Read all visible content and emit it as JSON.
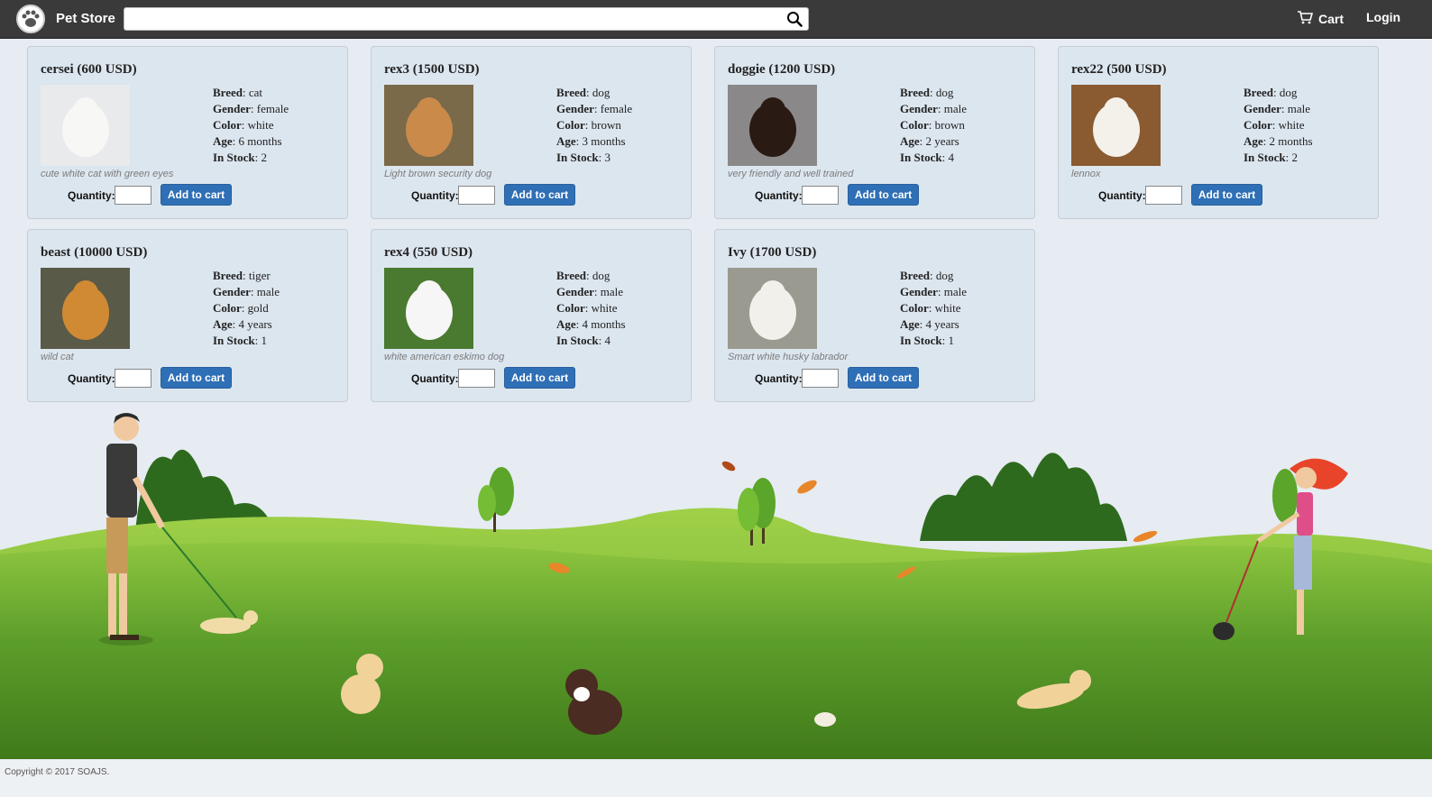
{
  "header": {
    "brand": "Pet Store",
    "search": {
      "value": "",
      "placeholder": ""
    },
    "cart_label": "Cart",
    "login_label": "Login"
  },
  "labels": {
    "breed": "Breed",
    "gender": "Gender",
    "color": "Color",
    "age": "Age",
    "in_stock": "In Stock",
    "quantity": "Quantity:",
    "add_to_cart": "Add to cart"
  },
  "pets": [
    {
      "title": "cersei (600 USD)",
      "breed": "cat",
      "gender": "female",
      "color": "white",
      "age": "6 months",
      "in_stock": "2",
      "description": "cute white cat with green eyes"
    },
    {
      "title": "rex3 (1500 USD)",
      "breed": "dog",
      "gender": "female",
      "color": "brown",
      "age": "3 months",
      "in_stock": "3",
      "description": "Light brown security dog"
    },
    {
      "title": "doggie (1200 USD)",
      "breed": "dog",
      "gender": "male",
      "color": "brown",
      "age": "2 years",
      "in_stock": "4",
      "description": "very friendly and well trained"
    },
    {
      "title": "rex22 (500 USD)",
      "breed": "dog",
      "gender": "male",
      "color": "white",
      "age": "2 months",
      "in_stock": "2",
      "description": "lennox"
    },
    {
      "title": "beast (10000 USD)",
      "breed": "tiger",
      "gender": "male",
      "color": "gold",
      "age": "4 years",
      "in_stock": "1",
      "description": "wild cat"
    },
    {
      "title": "rex4 (550 USD)",
      "breed": "dog",
      "gender": "male",
      "color": "white",
      "age": "4 months",
      "in_stock": "4",
      "description": "white american eskimo dog"
    },
    {
      "title": "Ivy (1700 USD)",
      "breed": "dog",
      "gender": "male",
      "color": "white",
      "age": "4 years",
      "in_stock": "1",
      "description": "Smart white husky labrador"
    }
  ],
  "footer": {
    "copyright": "Copyright © 2017 SOAJS."
  },
  "colors": {
    "navbar": "#3a3a3a",
    "button": "#2f6fb6",
    "card": "#dce6ef",
    "grass": "#5a9a2a"
  },
  "icons": {
    "brand": "paw-icon",
    "search": "search-icon",
    "cart": "cart-icon"
  }
}
